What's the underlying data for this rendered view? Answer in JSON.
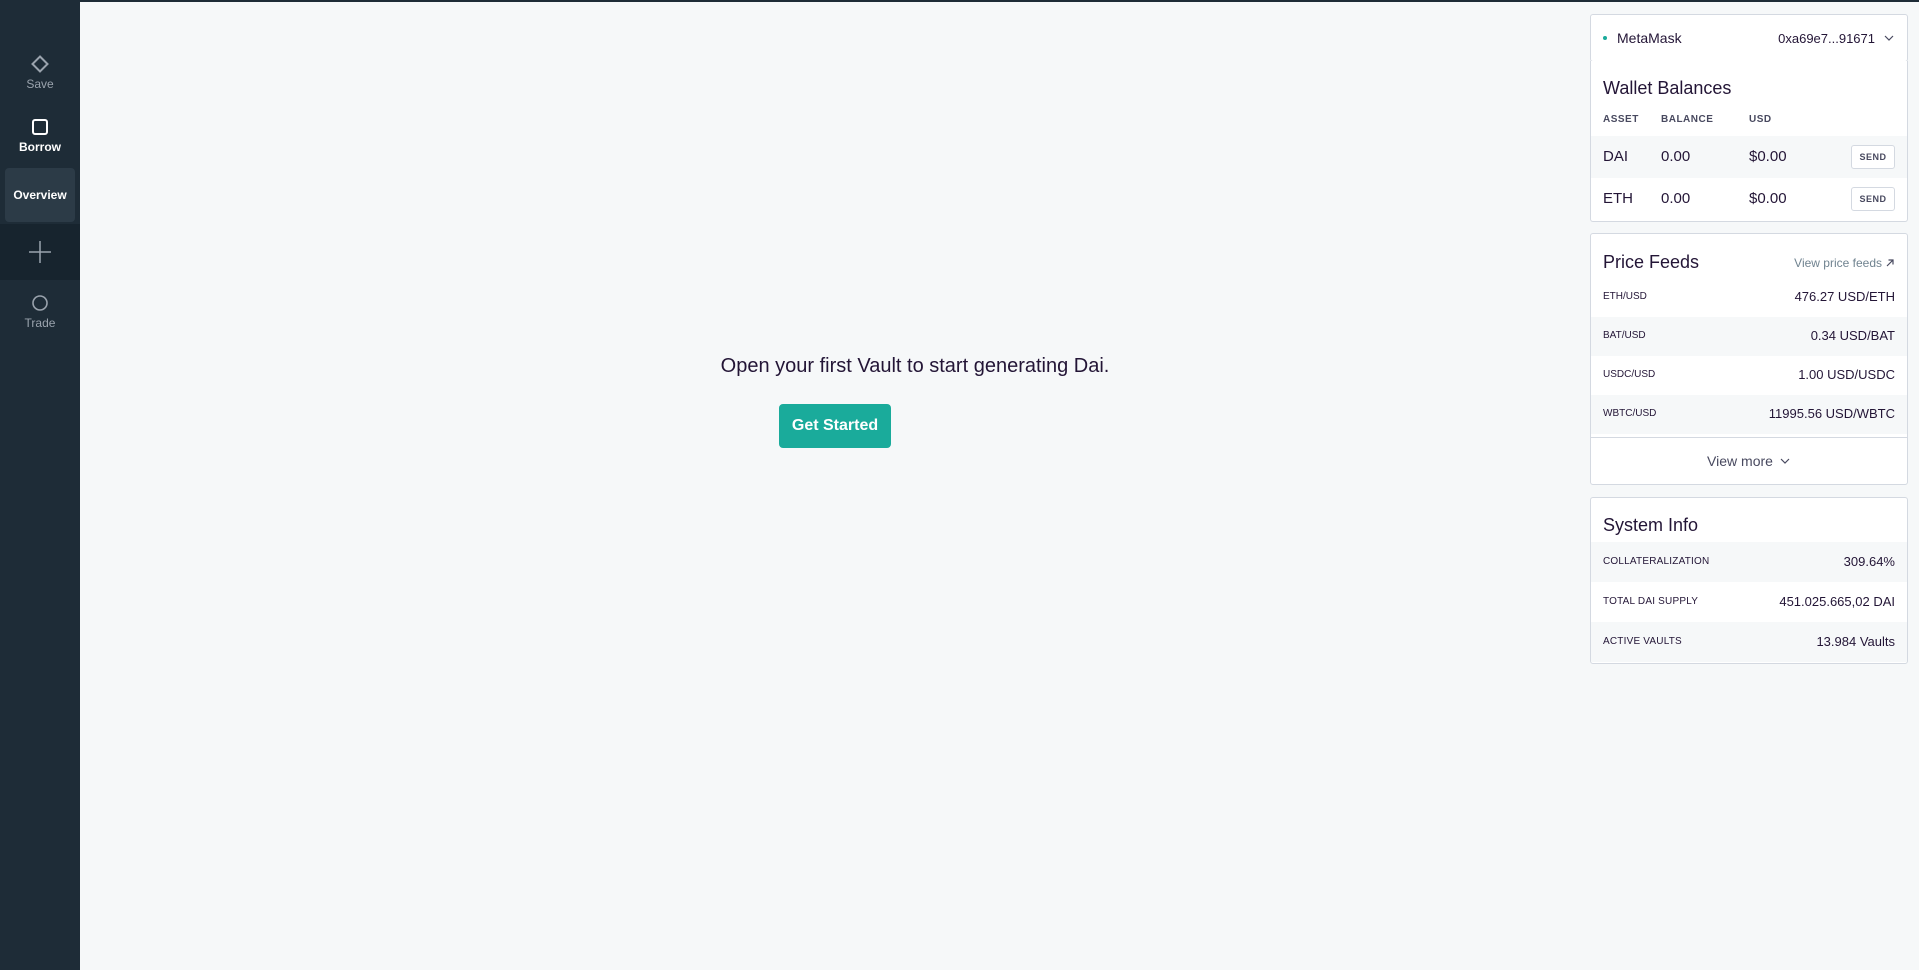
{
  "sidebar": {
    "save_label": "Save",
    "borrow_label": "Borrow",
    "overview_label": "Overview",
    "trade_label": "Trade"
  },
  "main": {
    "message": "Open your first Vault to start generating Dai.",
    "cta_label": "Get Started"
  },
  "account": {
    "wallet_name": "MetaMask",
    "address": "0xa69e7...91671"
  },
  "wallet_balances": {
    "title": "Wallet Balances",
    "headers": {
      "asset": "ASSET",
      "balance": "BALANCE",
      "usd": "USD"
    },
    "rows": [
      {
        "asset": "DAI",
        "balance": "0.00",
        "usd": "$0.00",
        "action": "SEND"
      },
      {
        "asset": "ETH",
        "balance": "0.00",
        "usd": "$0.00",
        "action": "SEND"
      }
    ]
  },
  "price_feeds": {
    "title": "Price Feeds",
    "link_label": "View price feeds",
    "rows": [
      {
        "pair": "ETH/USD",
        "price": "476.27 USD/ETH"
      },
      {
        "pair": "BAT/USD",
        "price": "0.34 USD/BAT"
      },
      {
        "pair": "USDC/USD",
        "price": "1.00 USD/USDC"
      },
      {
        "pair": "WBTC/USD",
        "price": "11995.56 USD/WBTC"
      }
    ],
    "view_more_label": "View more"
  },
  "system_info": {
    "title": "System Info",
    "rows": [
      {
        "key": "COLLATERALIZATION",
        "value": "309.64%"
      },
      {
        "key": "TOTAL DAI SUPPLY",
        "value": "451.025.665,02 DAI"
      },
      {
        "key": "ACTIVE VAULTS",
        "value": "13.984 Vaults"
      }
    ]
  },
  "colors": {
    "sidebar_bg": "#1e2c37",
    "accent": "#1aab9b",
    "page_bg": "#f6f8f9"
  }
}
